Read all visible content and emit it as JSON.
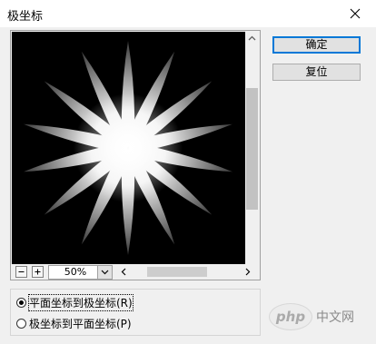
{
  "window": {
    "title": "极坐标"
  },
  "buttons": {
    "ok": "确定",
    "reset": "复位"
  },
  "preview": {
    "zoom_value": "50%",
    "zoom_out_icon": "minus-icon",
    "zoom_in_icon": "plus-icon"
  },
  "options": {
    "radio_1": {
      "label": "平面坐标到极坐标(R)",
      "checked": true
    },
    "radio_2": {
      "label": "极坐标到平面坐标(P)",
      "checked": false
    }
  },
  "watermark": {
    "logo_text": "php",
    "text": "中文网"
  },
  "colors": {
    "accent": "#0078d7",
    "dialog_bg": "#f0f0f0",
    "preview_bg": "#000000"
  }
}
